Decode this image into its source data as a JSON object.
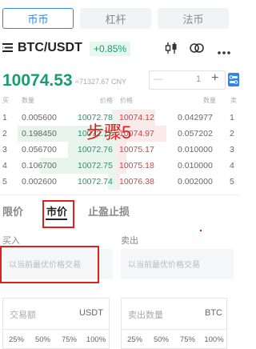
{
  "top_tabs": [
    {
      "label": "币币",
      "active": true
    },
    {
      "label": "杠杆",
      "active": false
    },
    {
      "label": "法币",
      "active": false
    }
  ],
  "header": {
    "pair": "BTC/USDT",
    "change": "+0.85%",
    "icons": [
      "menu-icon",
      "candle-chart-icon",
      "infinity-icon",
      "more-icon"
    ]
  },
  "ticker": {
    "price": "10074.53",
    "cny": "≈71327.67 CNY",
    "stepper_value": "1",
    "minus": "—",
    "plus": "+"
  },
  "orderbook": {
    "headers": {
      "left_buy": "买",
      "left_qty": "数量",
      "bid_price": "价格",
      "ask_price": "价格",
      "right_qty": "数量",
      "right_sell": "卖"
    },
    "rows": [
      {
        "idx": "1",
        "bid_qty": "0.005600",
        "bid_price": "10072.78",
        "ask_price": "10074.12",
        "ask_qty": "0.042977",
        "ask_idx": "1"
      },
      {
        "idx": "2",
        "bid_qty": "0.198450",
        "bid_price": "10072.77",
        "ask_price": "10074.97",
        "ask_qty": "0.057202",
        "ask_idx": "2"
      },
      {
        "idx": "3",
        "bid_qty": "0.056700",
        "bid_price": "10072.76",
        "ask_price": "10075.17",
        "ask_qty": "0.010000",
        "ask_idx": "3"
      },
      {
        "idx": "4",
        "bid_qty": "0.106700",
        "bid_price": "10072.75",
        "ask_price": "10075.18",
        "ask_qty": "0.010000",
        "ask_idx": "4"
      },
      {
        "idx": "5",
        "bid_qty": "0.002600",
        "bid_price": "10072.74",
        "ask_price": "10076.38",
        "ask_qty": "0.002000",
        "ask_idx": "5"
      }
    ],
    "overlay": "步骤5"
  },
  "order_tabs": [
    {
      "label": "限价",
      "active": false
    },
    {
      "label": "市价",
      "active": true
    },
    {
      "label": "止盈止损",
      "active": false
    }
  ],
  "buy": {
    "label": "买入",
    "price_placeholder": "以当前最优价格交易",
    "amount_label": "交易额",
    "amount_unit": "USDT",
    "percents": [
      "25%",
      "50%",
      "75%",
      "100%"
    ]
  },
  "sell": {
    "label": "卖出",
    "price_placeholder": "以当前最优价格交易",
    "amount_label": "卖出数量",
    "amount_unit": "BTC",
    "percents": [
      "25%",
      "50%",
      "75%",
      "100%"
    ]
  },
  "colors": {
    "accent": "#2f86e8",
    "up": "#1a9c6e",
    "down": "#d0453c",
    "highlight": "#e0201b"
  }
}
